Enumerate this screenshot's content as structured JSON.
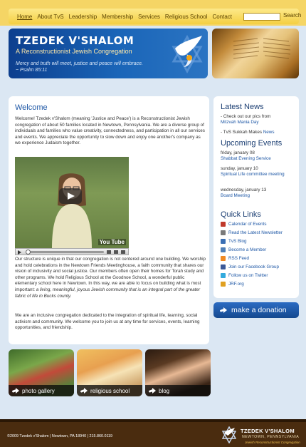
{
  "nav": {
    "items": [
      "Home",
      "About TvS",
      "Leadership",
      "Membership",
      "Services",
      "Religious School",
      "Contact"
    ],
    "search_label": "Search"
  },
  "banner": {
    "title": "TZEDEK V'SHALOM",
    "subtitle": "A Reconstructionist Jewish Congregation",
    "quote_line1": "Mercy and truth will meet, justice and peace will embrace.",
    "quote_line2": "~ Psalm 85:11"
  },
  "main": {
    "title": "Welcome",
    "intro": "Welcome! Tzedek v'Shalom (meaning 'Justice and Peace') is a Reconstructionist Jewish congregation of about 50 families located in Newtown, Pennsylvania. We are a diverse group of individuals and families who value creativity, connectedness, and participation in all our services and events. We appreciate the opportunity to slow down and enjoy one another's company as we experience Judaism together.",
    "structure_a": "Our structure is unique in that our congregation is not centered around one building. We worship and hold celebrations in the Newtown Friends Meetinghouse, a faith community that shares our vision of inclusivity and social justice. Our members often open their homes for Torah study and other programs. We hold Religious School at the Goodnoe School, a wonderful public elementary school here in Newtown.  In this way, we are able to focus on building what is most important: ",
    "structure_em": "a living, meaningful, joyous Jewish community that is an integral part of the greater fabric of life in Bucks county.",
    "closing": "We are an inclusive congregation dedicated to the integration of spiritual life, learning, social activism and community. We welcome you to join us at any time for services, events, learning opportunities, and friendship.",
    "video_brand": "You Tube"
  },
  "sidebar": {
    "news_title": "Latest News",
    "news1_text": "- Check out our pics from",
    "news1_link": "Mitzvah Mania Day",
    "news2_text": "- TvS Sukkah Makes",
    "news2_link": "News",
    "events_title": "Upcoming Events",
    "events": [
      {
        "date": "friday, january 08",
        "name": "Shabbat Evening Service"
      },
      {
        "date": "sunday, january 10",
        "name": "Spiritual Life committee meeting"
      },
      {
        "date": "wednesday, january 13",
        "name": "Board Meeting"
      }
    ],
    "links_title": "Quick Links",
    "quick_links": [
      {
        "label": "Calendar of Events",
        "icon": "calendar-icon",
        "color": "#c0392b"
      },
      {
        "label": "Read the Latest Newsletter",
        "icon": "newsletter-icon",
        "color": "#7a7a7a"
      },
      {
        "label": "TvS Blog",
        "icon": "blog-icon",
        "color": "#3a6fb5"
      },
      {
        "label": "Become a Member",
        "icon": "member-icon",
        "color": "#4f7fb8"
      },
      {
        "label": "RSS Feed",
        "icon": "rss-icon",
        "color": "#f08a24"
      },
      {
        "label": "Join our Facebook Group",
        "icon": "facebook-icon",
        "color": "#3b5998"
      },
      {
        "label": "Follow us on Twitter",
        "icon": "twitter-icon",
        "color": "#33aadd"
      },
      {
        "label": "JRF.org",
        "icon": "jrf-icon",
        "color": "#e0a020"
      }
    ]
  },
  "donate": {
    "label": "make a donation"
  },
  "tiles": [
    {
      "label": "photo gallery"
    },
    {
      "label": "religious school"
    },
    {
      "label": "blog"
    }
  ],
  "footer": {
    "copyright": "©2009 Tzedek v'Shalom | Newtown, PA 18940 | 215.860.0119",
    "name": "TZEDEK V'SHALOM",
    "location": "NEWTOWN, PENNSYLVANIA",
    "tagline": "Jewish Reconstructionist Congregation"
  }
}
